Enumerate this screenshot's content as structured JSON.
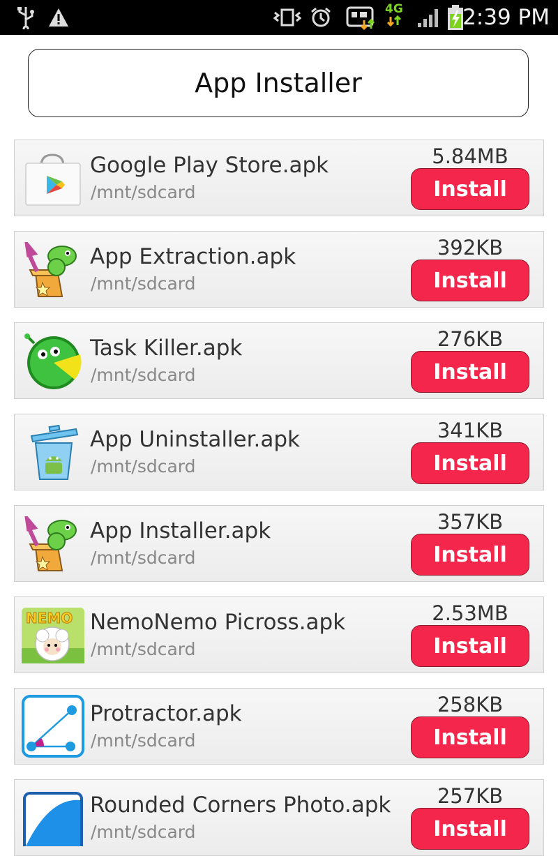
{
  "status_bar": {
    "time": "2:39 PM",
    "network": "4G",
    "icons": [
      "usb-icon",
      "warning-icon",
      "vibrate-icon",
      "alarm-icon",
      "sync-icon",
      "network-4g-icon",
      "signal-icon",
      "battery-charging-icon"
    ]
  },
  "title": "App Installer",
  "apps": [
    {
      "name": "Google Play Store.apk",
      "path": "/mnt/sdcard",
      "size": "5.84MB",
      "button": "Install",
      "icon": "play-store-icon"
    },
    {
      "name": "App Extraction.apk",
      "path": "/mnt/sdcard",
      "size": "392KB",
      "button": "Install",
      "icon": "app-extraction-icon"
    },
    {
      "name": "Task Killer.apk",
      "path": "/mnt/sdcard",
      "size": "276KB",
      "button": "Install",
      "icon": "task-killer-icon"
    },
    {
      "name": "App Uninstaller.apk",
      "path": "/mnt/sdcard",
      "size": "341KB",
      "button": "Install",
      "icon": "trash-android-icon"
    },
    {
      "name": "App Installer.apk",
      "path": "/mnt/sdcard",
      "size": "357KB",
      "button": "Install",
      "icon": "app-installer-icon"
    },
    {
      "name": "NemoNemo Picross.apk",
      "path": "/mnt/sdcard",
      "size": "2.53MB",
      "button": "Install",
      "icon": "nemonemo-icon"
    },
    {
      "name": "Protractor.apk",
      "path": "/mnt/sdcard",
      "size": "258KB",
      "button": "Install",
      "icon": "protractor-icon"
    },
    {
      "name": "Rounded Corners Photo.apk",
      "path": "/mnt/sdcard",
      "size": "257KB",
      "button": "Install",
      "icon": "rounded-photo-icon"
    }
  ],
  "icon_text": {
    "nemo": "NEMO"
  },
  "colors": {
    "install_button": "#f5264b",
    "status_bar": "#000000",
    "network_4g": "#7ed321"
  }
}
